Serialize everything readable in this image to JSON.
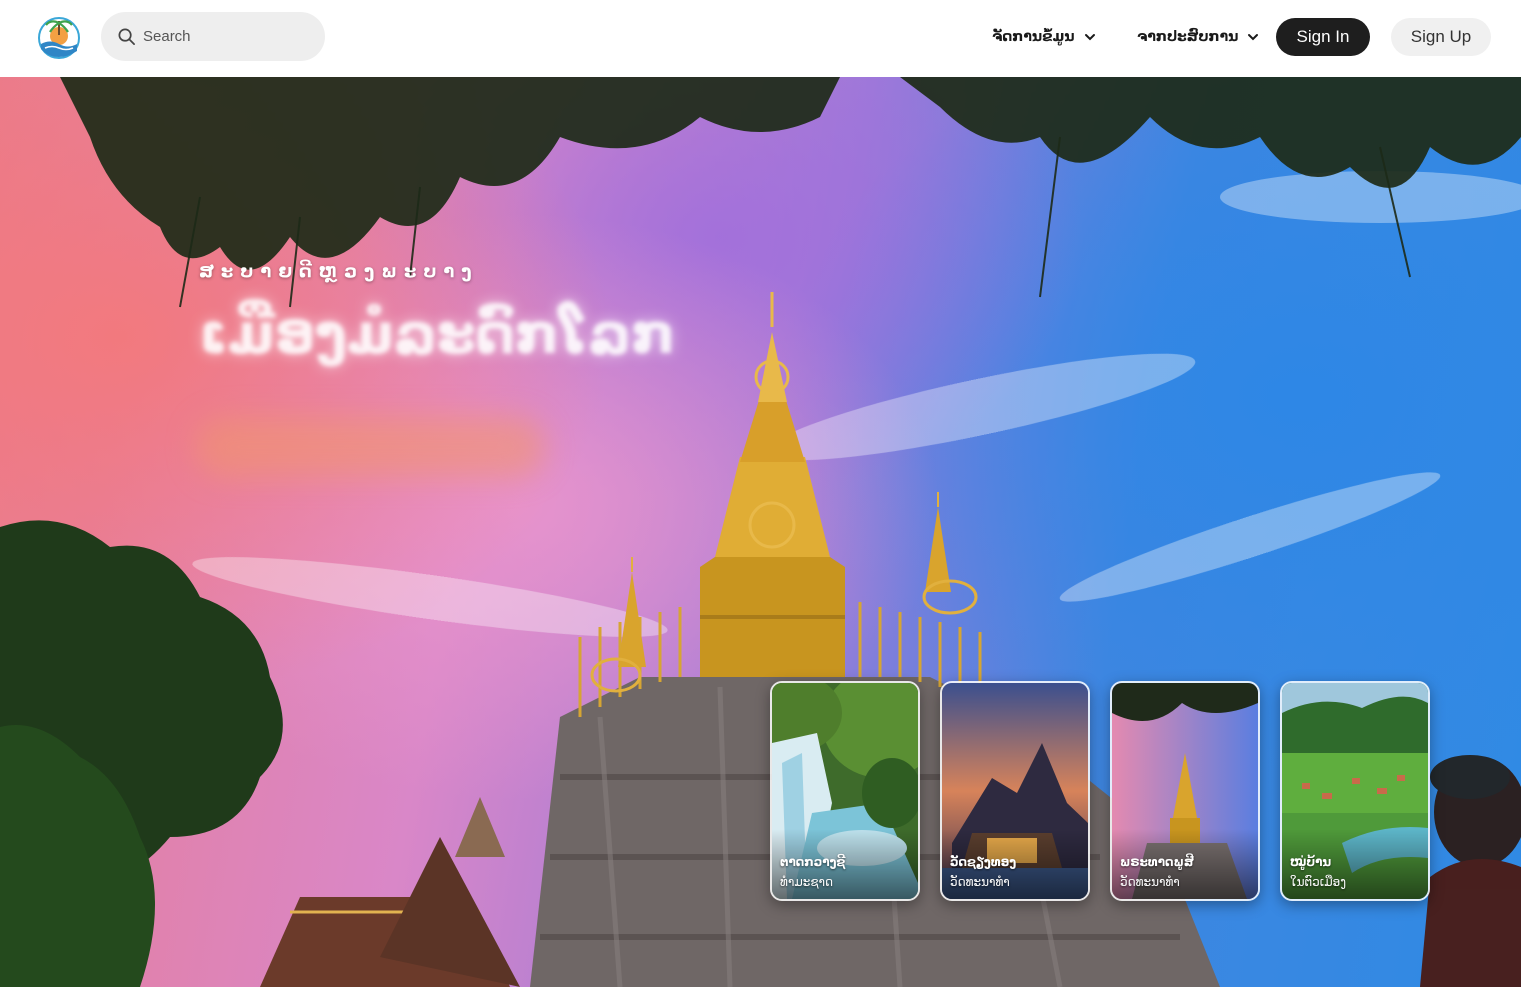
{
  "header": {
    "logo": "travel-logo-icon",
    "search": {
      "placeholder": "Search",
      "value": "",
      "icon": "search-icon"
    },
    "nav": [
      {
        "label": "ຈັດການຂໍ້ມູນ",
        "icon": "chevron-down-icon"
      },
      {
        "label": "ຈາກປະສົບການ",
        "icon": "chevron-down-icon"
      }
    ],
    "sign_in_label": "Sign In",
    "sign_up_label": "Sign Up"
  },
  "hero": {
    "kicker": "ສະບາຍດີຫຼວງພະບາງ",
    "headline": "ເມືອງມໍລະດົກໂລກ"
  },
  "cards": [
    {
      "title": "ຕາດກວາງຊີ",
      "subtitle": "ທຳມະຊາດ",
      "image": "waterfall-photo"
    },
    {
      "title": "ວັດຊຽງທອງ",
      "subtitle": "ວັດທະນາທຳ",
      "image": "temple-photo"
    },
    {
      "title": "ພຣະທາດພູສີ",
      "subtitle": "ວັດທະນາທຳ",
      "image": "stupa-photo"
    },
    {
      "title": "ໝູ່ບ້ານ",
      "subtitle": "ໃນຕົວເມືອງ",
      "image": "valley-photo"
    }
  ],
  "colors": {
    "sign_in_bg": "#1e1e1e",
    "sign_up_bg": "#f0f0f0",
    "search_bg": "#eeeeee",
    "sky_pink": "#e97c8e",
    "sky_blue": "#2f8ae4",
    "gold": "#d6a532"
  }
}
